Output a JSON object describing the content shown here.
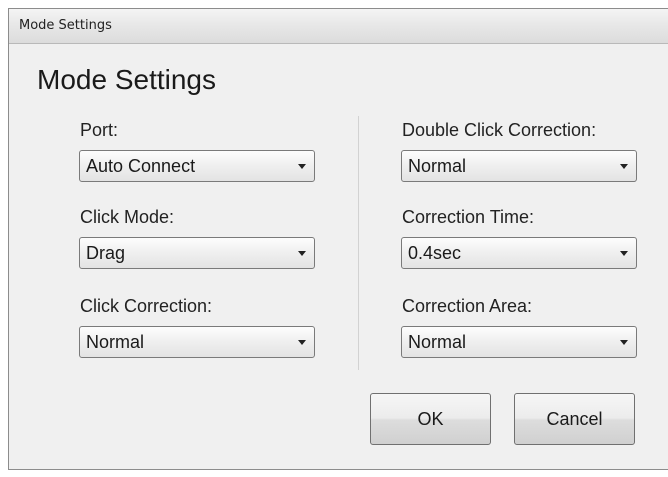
{
  "window": {
    "title": "Mode Settings"
  },
  "dialog": {
    "heading": "Mode Settings",
    "left_column": {
      "port": {
        "label": "Port:",
        "value": "Auto Connect"
      },
      "click_mode": {
        "label": "Click Mode:",
        "value": "Drag"
      },
      "click_correction": {
        "label": "Click Correction:",
        "value": "Normal"
      }
    },
    "right_column": {
      "double_click_correction": {
        "label": "Double Click Correction:",
        "value": "Normal"
      },
      "correction_time": {
        "label": "Correction Time:",
        "value": "0.4sec"
      },
      "correction_area": {
        "label": "Correction Area:",
        "value": "Normal"
      }
    },
    "buttons": {
      "ok": "OK",
      "cancel": "Cancel"
    }
  },
  "icons": {
    "dropdown": "chevron-down-icon"
  }
}
